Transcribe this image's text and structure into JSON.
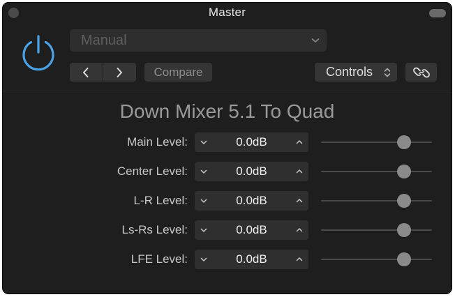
{
  "window": {
    "title": "Master"
  },
  "power": {
    "icon": "power-icon",
    "color": "#4aa3e8"
  },
  "preset": {
    "value": "Manual"
  },
  "toolbar": {
    "compare_label": "Compare",
    "view_mode": "Controls"
  },
  "plugin": {
    "title": "Down Mixer 5.1 To Quad"
  },
  "params": [
    {
      "label": "Main Level:",
      "value": "0.0dB",
      "slider_fraction": 0.75
    },
    {
      "label": "Center Level:",
      "value": "0.0dB",
      "slider_fraction": 0.75
    },
    {
      "label": "L-R Level:",
      "value": "0.0dB",
      "slider_fraction": 0.75
    },
    {
      "label": "Ls-Rs Level:",
      "value": "0.0dB",
      "slider_fraction": 0.75
    },
    {
      "label": "LFE Level:",
      "value": "0.0dB",
      "slider_fraction": 0.75
    }
  ]
}
